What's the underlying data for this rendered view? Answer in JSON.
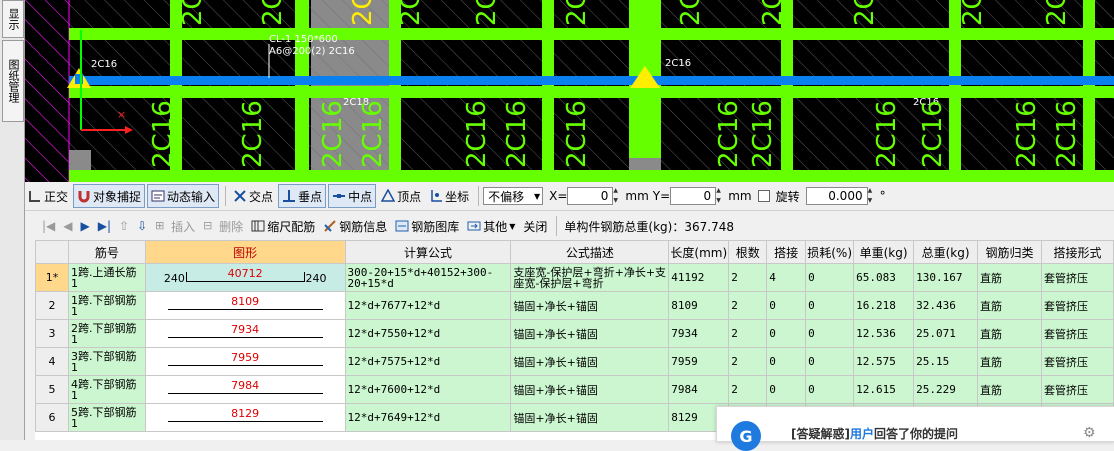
{
  "left_tabs": [
    "显示",
    "图纸管理"
  ],
  "cad": {
    "labels": {
      "beam_tag": "CL-1 150*600",
      "stirrup_tag": "A6@200(2) 2C16",
      "top_left_bar": "2C16",
      "top_right_bar": "2C16",
      "mid_bar": "2C18",
      "right_bar": "2C16",
      "vertical_bar": "2C16",
      "top_vertical": "2C16",
      "top_vertical_yellow": "2C16"
    }
  },
  "snap_toolbar": {
    "orthogonal": "正交",
    "object_snap": "对象捕捉",
    "dynamic_input": "动态输入",
    "intersection": "交点",
    "perpendicular": "垂点",
    "midpoint": "中点",
    "vertex": "顶点",
    "coordinate": "坐标",
    "offset_mode": "不偏移",
    "x_label": "X=",
    "x_value": "0",
    "x_unit": "mm",
    "y_label": "Y=",
    "y_value": "0",
    "y_unit": "mm",
    "rotate_label": "旋转",
    "rotate_value": "0.000",
    "degree": "°"
  },
  "rebar_toolbar": {
    "insert": "插入",
    "delete": "删除",
    "scale_rebar": "缩尺配筋",
    "rebar_info": "钢筋信息",
    "rebar_library": "钢筋图库",
    "other": "其他",
    "close": "关闭",
    "total_weight": "单构件钢筋总重(kg)：367.748"
  },
  "table": {
    "columns": [
      "",
      "筋号",
      "图形",
      "计算公式",
      "公式描述",
      "长度(mm)",
      "根数",
      "搭接",
      "损耗(%)",
      "单重(kg)",
      "总重(kg)",
      "钢筋归类",
      "搭接形式"
    ],
    "rows": [
      {
        "rn": "1*",
        "name": "1跨.上通长筋1",
        "shape_left": "240",
        "shape_num": "40712",
        "shape_right": "240",
        "formula": "300-20+15*d+40152+300-20+15*d",
        "desc": "支座宽-保护层+弯折+净长+支座宽-保护层+弯折",
        "length": "41192",
        "count": "2",
        "lap": "4",
        "loss": "0",
        "unit_w": "65.083",
        "total_w": "130.167",
        "class": "直筋",
        "lap_type": "套管挤压"
      },
      {
        "rn": "2",
        "name": "1跨.下部钢筋1",
        "shape_num": "8109",
        "formula": "12*d+7677+12*d",
        "desc": "锚固+净长+锚固",
        "length": "8109",
        "count": "2",
        "lap": "0",
        "loss": "0",
        "unit_w": "16.218",
        "total_w": "32.436",
        "class": "直筋",
        "lap_type": "套管挤压"
      },
      {
        "rn": "3",
        "name": "2跨.下部钢筋1",
        "shape_num": "7934",
        "formula": "12*d+7550+12*d",
        "desc": "锚固+净长+锚固",
        "length": "7934",
        "count": "2",
        "lap": "0",
        "loss": "0",
        "unit_w": "12.536",
        "total_w": "25.071",
        "class": "直筋",
        "lap_type": "套管挤压"
      },
      {
        "rn": "4",
        "name": "3跨.下部钢筋1",
        "shape_num": "7959",
        "formula": "12*d+7575+12*d",
        "desc": "锚固+净长+锚固",
        "length": "7959",
        "count": "2",
        "lap": "0",
        "loss": "0",
        "unit_w": "12.575",
        "total_w": "25.15",
        "class": "直筋",
        "lap_type": "套管挤压"
      },
      {
        "rn": "5",
        "name": "4跨.下部钢筋1",
        "shape_num": "7984",
        "formula": "12*d+7600+12*d",
        "desc": "锚固+净长+锚固",
        "length": "7984",
        "count": "2",
        "lap": "0",
        "loss": "0",
        "unit_w": "12.615",
        "total_w": "25.229",
        "class": "直筋",
        "lap_type": "套管挤压"
      },
      {
        "rn": "6",
        "name": "5跨.下部钢筋1",
        "shape_num": "8129",
        "formula": "12*d+7649+12*d",
        "desc": "锚固+净长+锚固",
        "length": "8129",
        "count": "",
        "lap": "",
        "loss": "",
        "unit_w": "",
        "total_w": "",
        "class": "",
        "lap_type": ""
      }
    ]
  },
  "popup": {
    "prefix": "[答疑解惑]",
    "user": "用户",
    "text": "回答了你的提问"
  },
  "colors": {
    "cad_green": "#66ff00",
    "cad_blue": "#0a7ff0",
    "cad_yellow": "#ffee00",
    "row_green": "#ccf6d0",
    "header_highlight": "#ffd88c"
  }
}
